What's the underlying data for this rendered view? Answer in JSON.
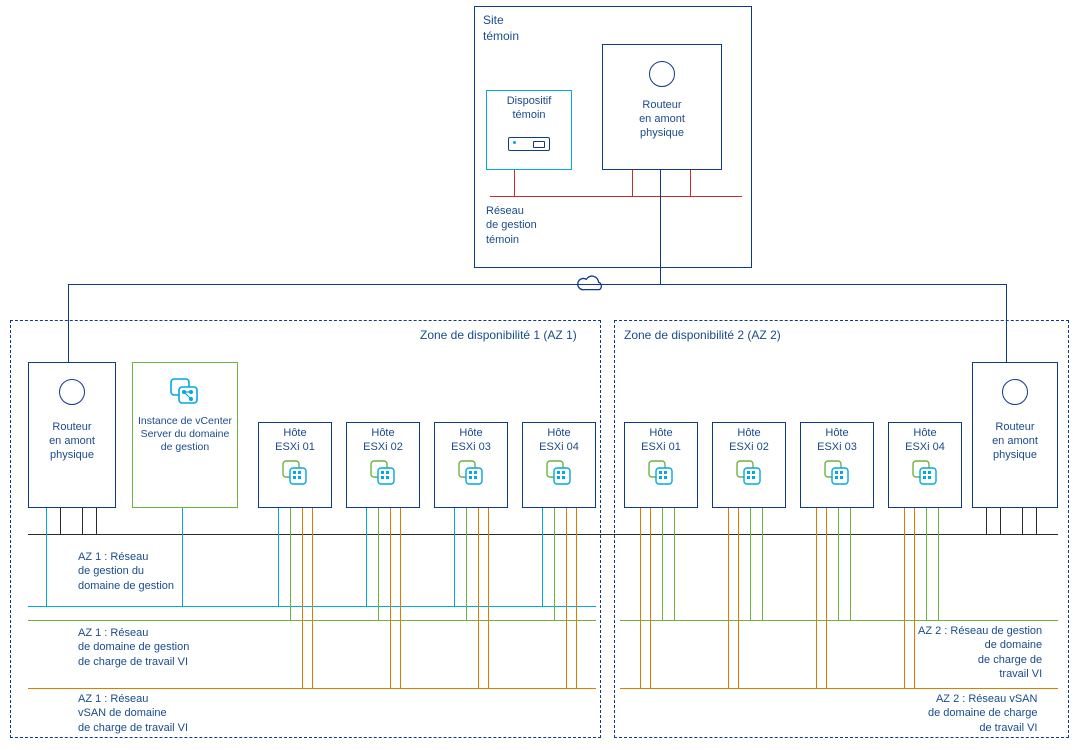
{
  "witness_site": {
    "title": "Site\ntémoin",
    "appliance_label": "Dispositif\ntémoin",
    "router_label": "Routeur\nen amont\nphysique",
    "mgmt_net_label": "Réseau\nde gestion\ntémoin"
  },
  "az1": {
    "title": "Zone de disponibilité 1 (AZ 1)",
    "router_label": "Routeur\nen amont\nphysique",
    "vcenter_label": "Instance de vCenter\nServer du domaine\nde gestion",
    "hosts": [
      "Hôte\nESXi 01",
      "Hôte\nESXi 02",
      "Hôte\nESXi 03",
      "Hôte\nESXi 04"
    ],
    "net_mgmt_label": "AZ 1 : Réseau\nde gestion du\ndomaine de gestion",
    "net_vi_mgmt_label": "AZ 1 : Réseau\nde domaine de gestion\nde charge de travail VI",
    "net_vsan_label": "AZ 1 : Réseau\nvSAN de domaine\nde charge de travail VI"
  },
  "az2": {
    "title": "Zone de disponibilité 2 (AZ 2)",
    "router_label": "Routeur\nen amont\nphysique",
    "hosts": [
      "Hôte\nESXi 01",
      "Hôte\nESXi 02",
      "Hôte\nESXi 03",
      "Hôte\nESXi 04"
    ],
    "net_vi_mgmt_label": "AZ 2 : Réseau de gestion\nde domaine\nde charge de\ntravail VI",
    "net_vsan_label": "AZ 2 : Réseau vSAN\nde domaine de charge\nde travail VI"
  }
}
